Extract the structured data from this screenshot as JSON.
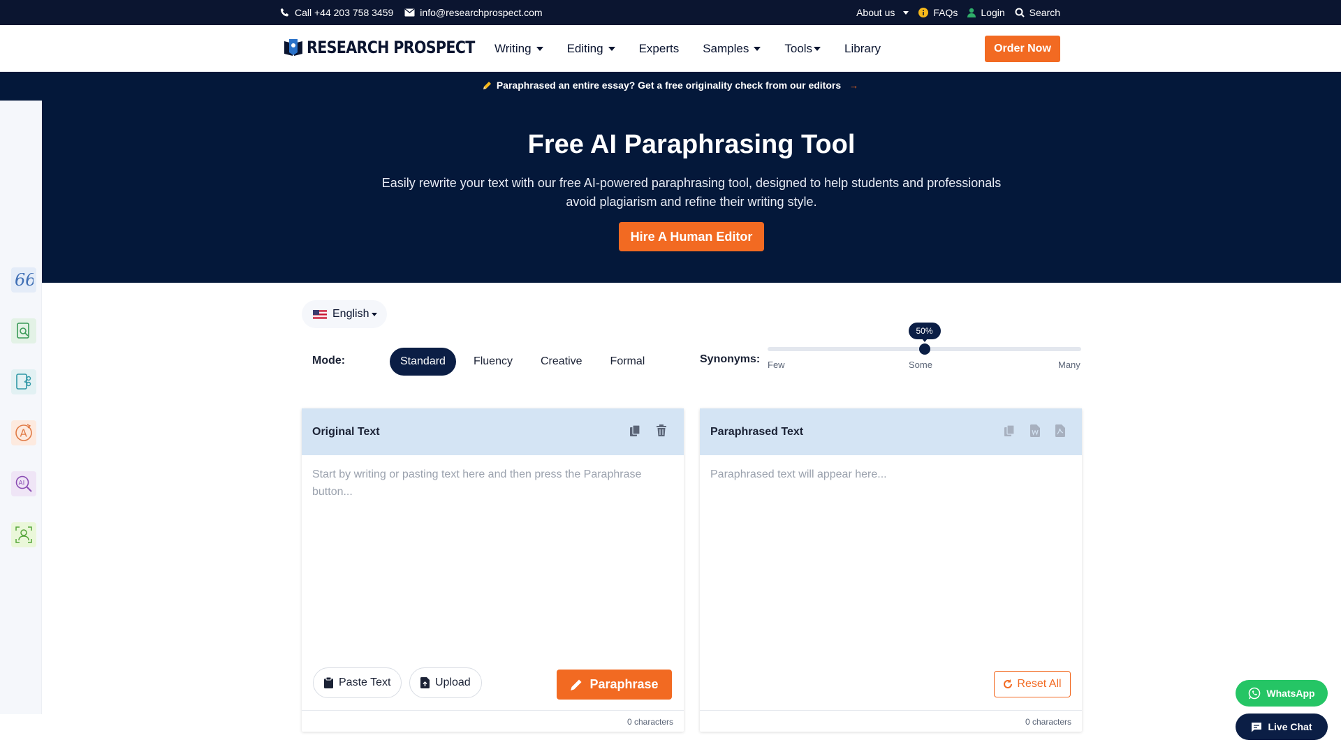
{
  "topbar": {
    "phone": "Call +44 203 758 3459",
    "email": "info@researchprospect.com",
    "about": "About us",
    "faqs": "FAQs",
    "login": "Login",
    "search": "Search"
  },
  "header": {
    "logo_text": "RESEARCH PROSPECT",
    "nav": [
      "Writing",
      "Editing",
      "Experts",
      "Samples",
      "Tools",
      "Library"
    ],
    "order_label": "Order Now"
  },
  "hero": {
    "promo": "Paraphrased an entire essay? Get a free originality check from our editors",
    "promo_arrow": "→",
    "title": "Free AI Paraphrasing Tool",
    "subtitle": "Easily rewrite your text with our free AI-powered paraphrasing tool, designed to help students and professionals avoid plagiarism and refine their writing style.",
    "cta": "Hire A Human Editor"
  },
  "sidebar": {
    "icons": [
      "quote-icon",
      "magnifier-doc-icon",
      "doc-scissors-icon",
      "letter-a-icon",
      "ai-search-icon",
      "person-icon"
    ],
    "colors": [
      "#e4ecf8",
      "#e3f2e6",
      "#e2f1f3",
      "#fdeadf",
      "#efe5f6",
      "#eaf7d9"
    ]
  },
  "tool": {
    "language": "English",
    "mode_label": "Mode:",
    "modes": [
      "Standard",
      "Fluency",
      "Creative",
      "Formal"
    ],
    "active_mode": "Standard",
    "synonyms_label": "Synonyms:",
    "synonyms_value": 0.5,
    "synonyms_value_label": "50%",
    "synonyms_ticks": [
      "Few",
      "Some",
      "Many"
    ]
  },
  "original": {
    "title": "Original Text",
    "placeholder": "Start by writing or pasting text here and then press the Paraphrase button...",
    "paste_label": "Paste Text",
    "upload_label": "Upload",
    "paraphrase_label": "Paraphrase",
    "char_count": "0 characters"
  },
  "paraphrased": {
    "title": "Paraphrased Text",
    "placeholder": "Paraphrased text will appear here...",
    "reset_label": "Reset All",
    "char_count": "0 characters"
  },
  "floating": {
    "whatsapp": "WhatsApp",
    "live_chat": "Live Chat"
  },
  "colors": {
    "navy": "#04183a",
    "accent": "#f26a22",
    "whatsapp": "#25c565"
  }
}
